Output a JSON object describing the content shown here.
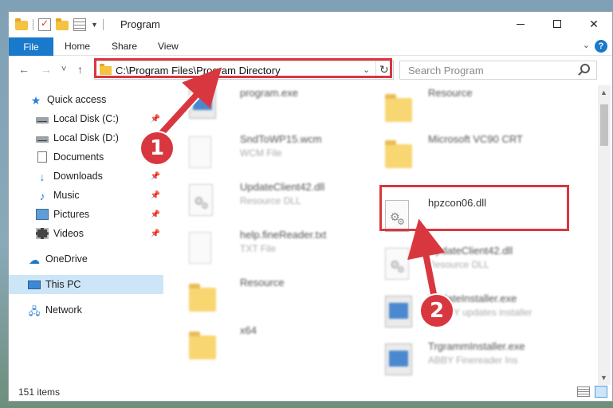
{
  "window": {
    "title": "Program"
  },
  "ribbon": {
    "file": "File",
    "home": "Home",
    "share": "Share",
    "view": "View",
    "help": "?"
  },
  "nav": {
    "back": "←",
    "forward": "→",
    "recent": "˅",
    "up": "↑",
    "address": "C:\\Program Files\\Program Directory",
    "refresh": "↻",
    "search_placeholder": "Search Program"
  },
  "sidebar": {
    "items": [
      {
        "label": "Quick access",
        "icon": "star-icon"
      },
      {
        "label": "Local Disk (C:)",
        "icon": "drive-icon",
        "pinned": true
      },
      {
        "label": "Local Disk (D:)",
        "icon": "drive-icon"
      },
      {
        "label": "Documents",
        "icon": "documents-icon"
      },
      {
        "label": "Downloads",
        "icon": "download-icon",
        "pinned": true
      },
      {
        "label": "Music",
        "icon": "music-icon",
        "pinned": true
      },
      {
        "label": "Pictures",
        "icon": "pictures-icon",
        "pinned": true
      },
      {
        "label": "Videos",
        "icon": "videos-icon",
        "pinned": true
      },
      {
        "label": "OneDrive",
        "icon": "cloud-icon"
      },
      {
        "label": "This PC",
        "icon": "computer-icon",
        "selected": true
      },
      {
        "label": "Network",
        "icon": "network-icon"
      }
    ],
    "pin_glyph": "📌"
  },
  "files": {
    "left": [
      {
        "name": "program.exe",
        "sub": "",
        "icon": "exe-icon"
      },
      {
        "name": "SndToWP15.wcm",
        "sub": "WCM File",
        "icon": "file-icon"
      },
      {
        "name": "UpdateClient42.dll",
        "sub": "Resource DLL",
        "icon": "dll-icon"
      },
      {
        "name": "help.fineReader.txt",
        "sub": "TXT File",
        "icon": "file-icon"
      },
      {
        "name": "Resource",
        "sub": "",
        "icon": "folder-icon"
      },
      {
        "name": "x64",
        "sub": "",
        "icon": "folder-icon"
      }
    ],
    "right": [
      {
        "name": "Resource",
        "sub": "",
        "icon": "folder-icon"
      },
      {
        "name": "Microsoft VC90 CRT",
        "sub": "",
        "icon": "folder-icon"
      },
      {
        "name": "hpzcon06.dll",
        "sub": "",
        "icon": "dll-icon",
        "highlighted": true
      },
      {
        "name": "UpdateClient42.dll",
        "sub": "Resource DLL",
        "icon": "dll-icon"
      },
      {
        "name": "UpdateInstaller.exe",
        "sub": "ABBYY updates installer",
        "icon": "exe-icon"
      },
      {
        "name": "TrgrammInstaller.exe",
        "sub": "ABBY Finereader Ins",
        "icon": "exe-icon"
      }
    ]
  },
  "status": {
    "items": "151 items"
  },
  "annotations": {
    "badge1": "1",
    "badge2": "2",
    "color": "#d9373f"
  }
}
